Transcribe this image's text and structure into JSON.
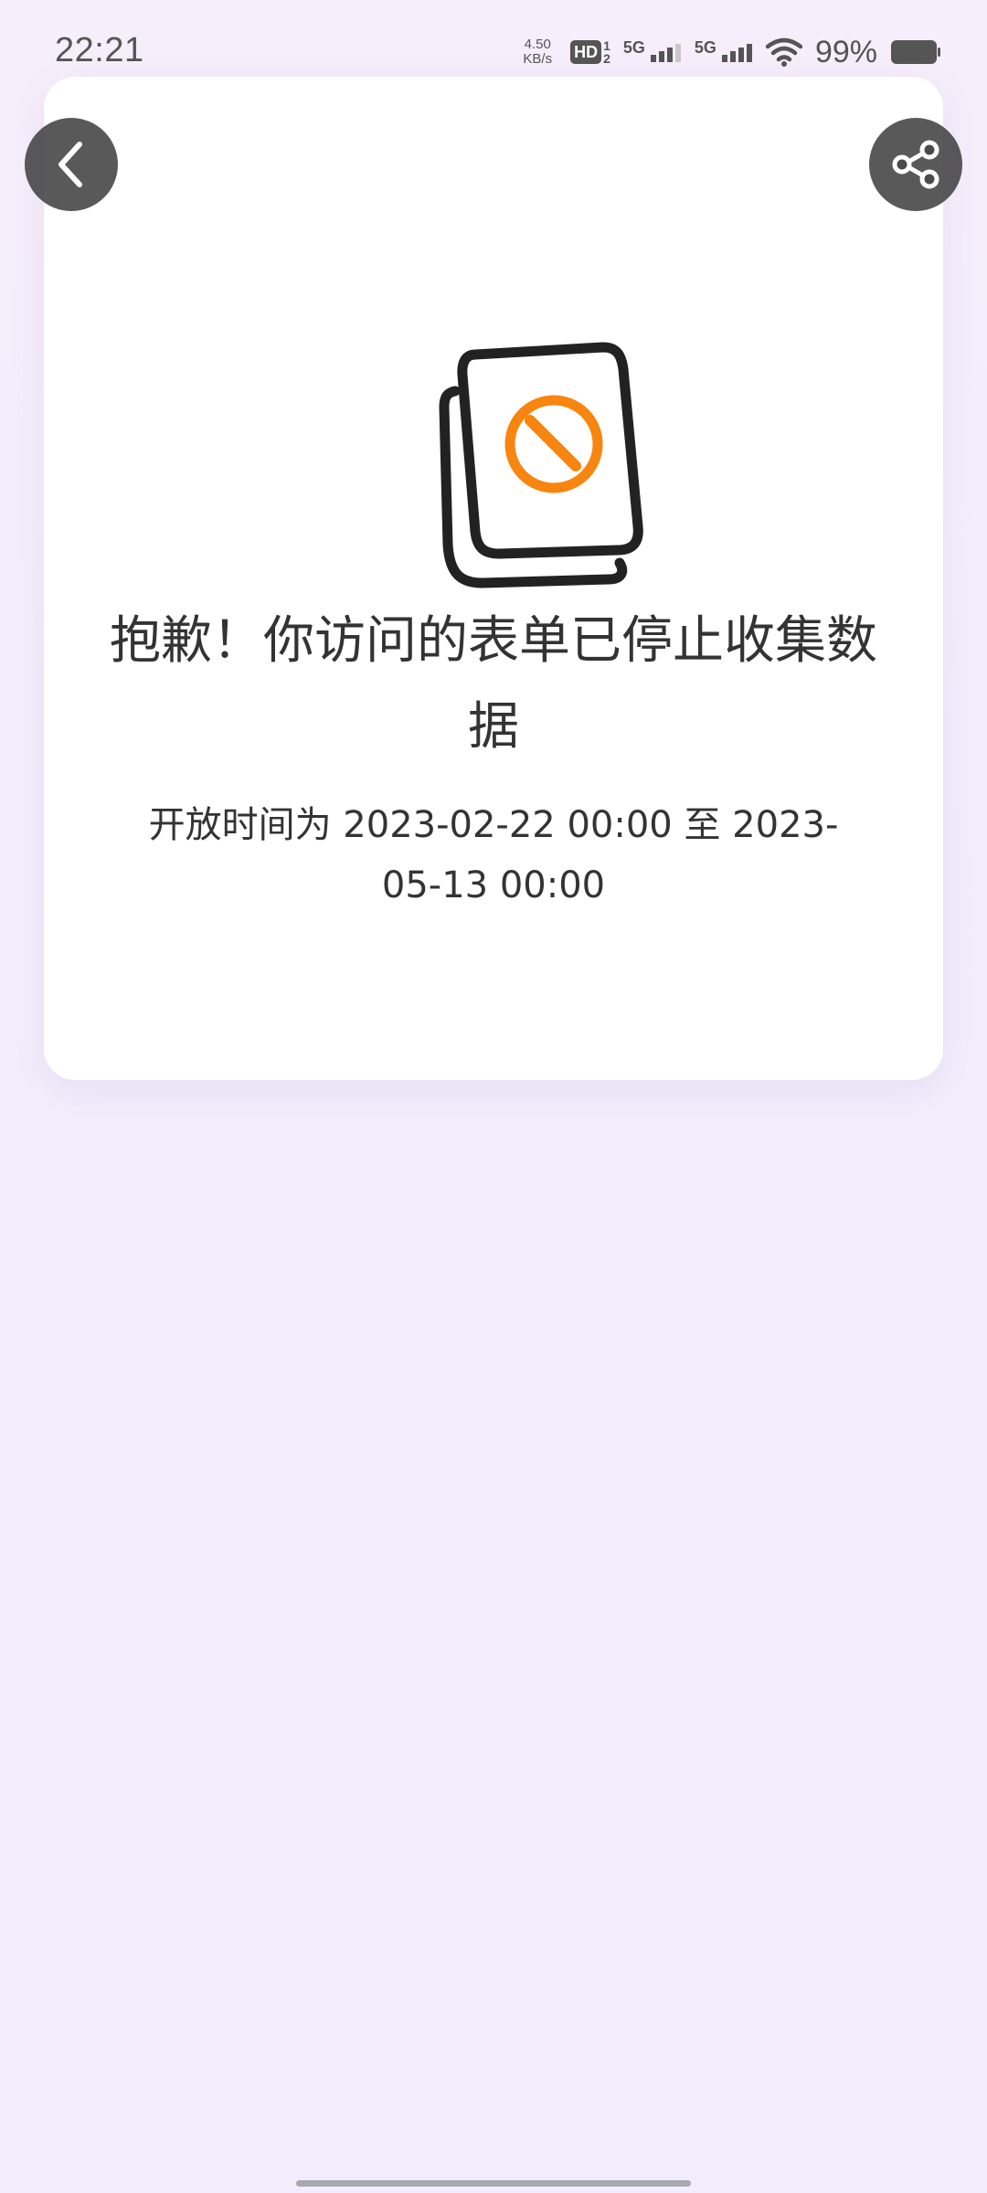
{
  "status_bar": {
    "time": "22:21",
    "net_speed_value": "4.50",
    "net_speed_unit": "KB/s",
    "hd_label": "HD",
    "hd_sub_top": "1",
    "hd_sub_bottom": "2",
    "sim1_label": "5G",
    "sim2_label": "5G",
    "battery_percent": "99%"
  },
  "header": {
    "back_icon": "chevron-left-icon",
    "share_icon": "share-icon"
  },
  "message": {
    "illustration_icon": "form-closed-icon",
    "title": "抱歉！你访问的表单已停止收集数据",
    "subtitle": "开放时间为 2023-02-22 00:00 至 2023-05-13 00:00"
  },
  "colors": {
    "accent": "#f7850f",
    "button_bg": "#3c3c3c",
    "text": "#333333",
    "background": "#f1edfd"
  }
}
